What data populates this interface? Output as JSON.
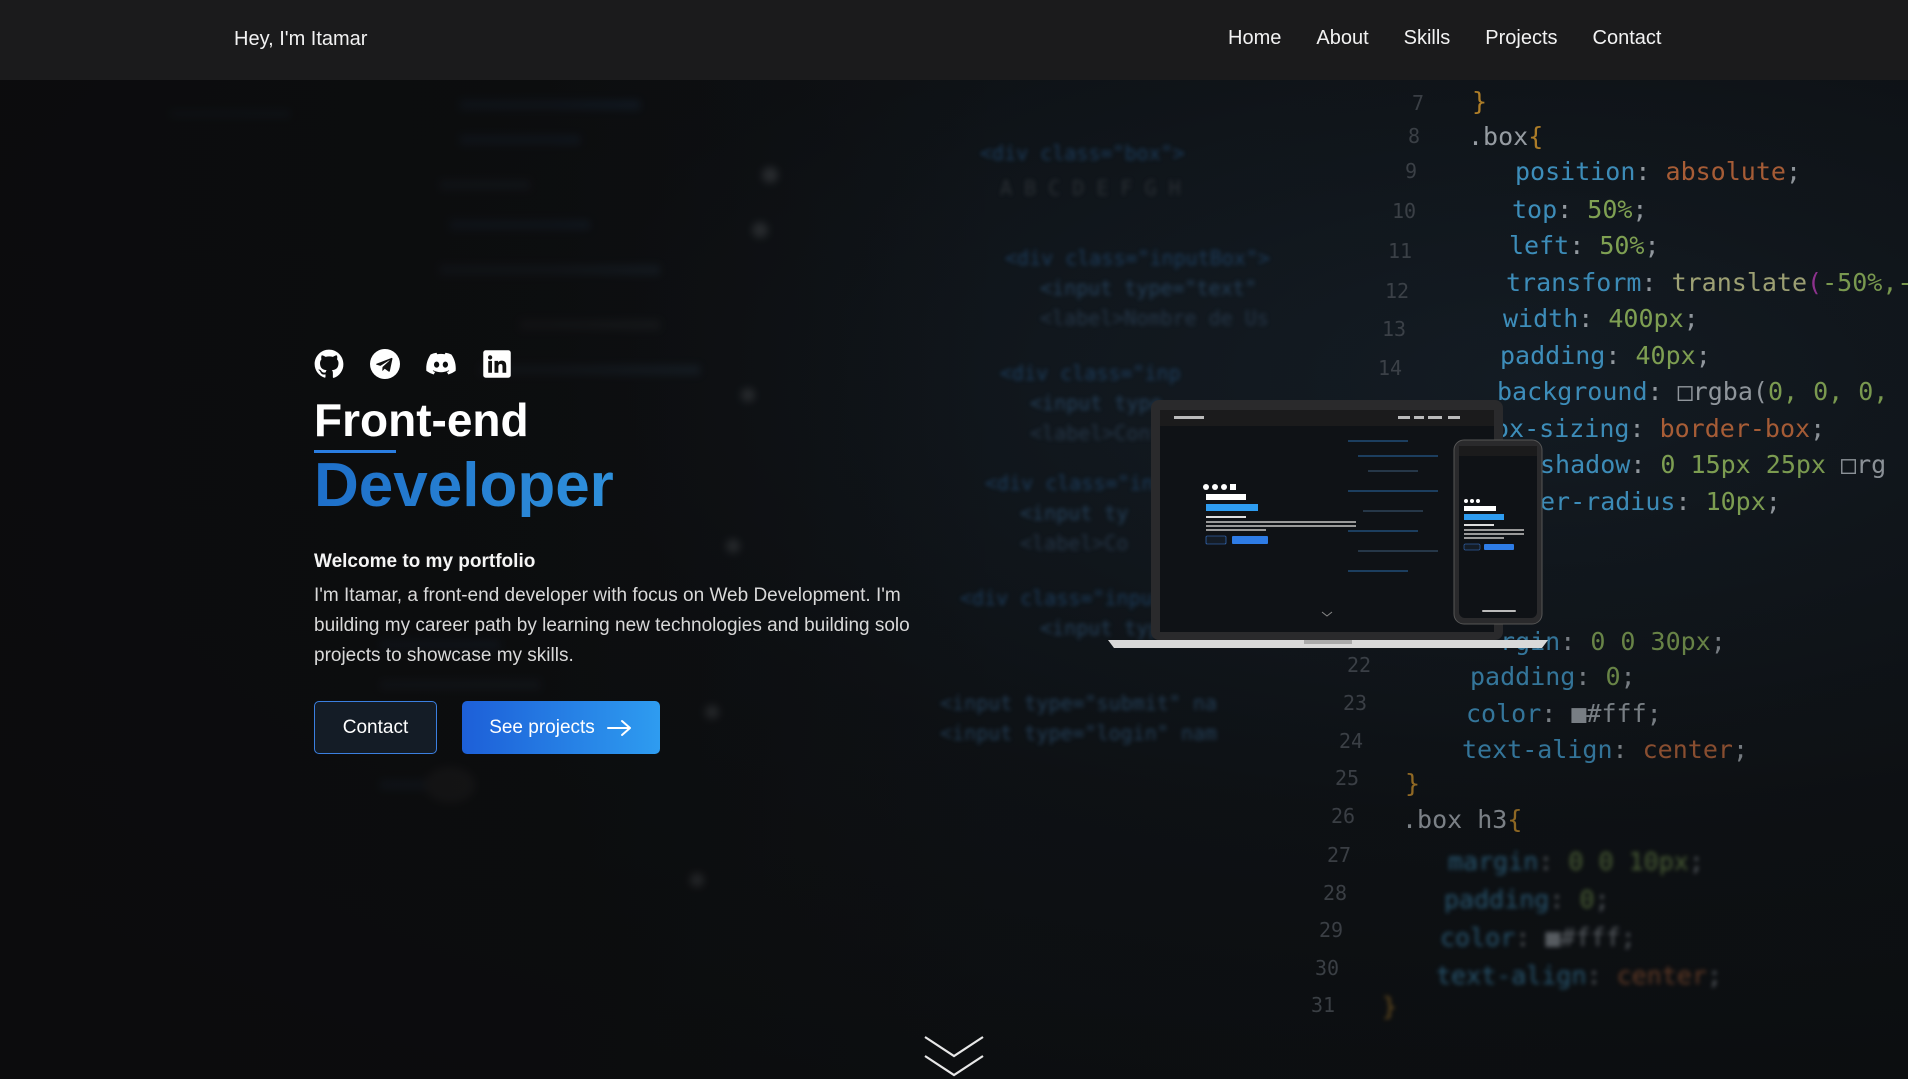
{
  "header": {
    "brand": "Hey, I'm Itamar",
    "nav": [
      "Home",
      "About",
      "Skills",
      "Projects",
      "Contact"
    ]
  },
  "hero": {
    "socials": [
      "github-icon",
      "telegram-icon",
      "discord-icon",
      "linkedin-icon"
    ],
    "title_line1": "Front-end",
    "title_line2": "Developer",
    "welcome": "Welcome to my portfolio",
    "description": "I'm Itamar, a front-end developer with focus on Web Development. I'm building my career path by learning new technologies and building solo projects to showcase my skills.",
    "contact_label": "Contact",
    "projects_label": "See projects"
  },
  "background_code": {
    "line_numbers": [
      "7",
      "8",
      "9",
      "10",
      "11",
      "12",
      "13",
      "14",
      "22",
      "23",
      "24",
      "25",
      "26",
      "27",
      "28",
      "29",
      "30",
      "31"
    ],
    "lines": [
      "}",
      ".box{",
      "position: absolute;",
      "top: 50%;",
      "left: 50%;",
      "transform: translate(-50%,-",
      "width: 400px;",
      "padding: 40px;",
      "background: rgba(0, 0, 0,",
      "ox-sizing: border-box;",
      "shadow: 0 15px 25px rg",
      "er-radius: 10px;",
      "rgin: 0 0 30px;",
      "padding: 0;",
      "color: #fff;",
      "text-align: center;",
      "}",
      ".box h3{",
      "margin: 0 0 10px;",
      "padding: 0;",
      "color: #fff;",
      "text-align: center;",
      "}"
    ]
  },
  "colors": {
    "accent": "#2e9cf0",
    "accent_dark": "#1d5fd8",
    "header_bg": "#1b1b1c",
    "page_bg": "#0d0d0e"
  }
}
